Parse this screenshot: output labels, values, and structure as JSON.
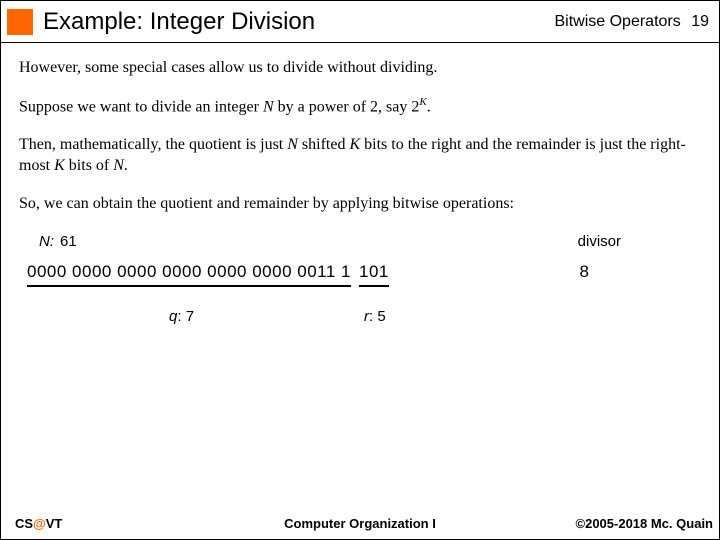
{
  "header": {
    "title": "Example: Integer Division",
    "section": "Bitwise Operators",
    "page": "19"
  },
  "body": {
    "p1": "However, some special cases allow us to divide without dividing.",
    "p2_a": "Suppose we want to divide an integer ",
    "p2_N": "N",
    "p2_b": " by a power of 2, say 2",
    "p2_K": "K",
    "p2_c": ".",
    "p3_a": "Then, mathematically, the quotient is just ",
    "p3_N1": "N",
    "p3_b": " shifted ",
    "p3_K1": "K",
    "p3_c": " bits to the right and the remainder is just the right-most ",
    "p3_K2": "K",
    "p3_d": " bits of ",
    "p3_N2": "N",
    "p3_e": ".",
    "p4": "So, we can obtain the quotient and remainder by applying bitwise operations:"
  },
  "example": {
    "n_label": "N",
    "n_colon": ":",
    "n_value": "61",
    "divisor_label": "divisor",
    "bits_main": "0000 0000 0000 0000 0000 0000 0011 1",
    "bits_tail": "101",
    "divisor_value": "8",
    "q_label": "q",
    "q_colon": ":",
    "q_value": "7",
    "r_label": "r",
    "r_colon": ":",
    "r_value": "5"
  },
  "footer": {
    "cs": "CS",
    "at": "@",
    "vt": "VT",
    "course": "Computer Organization I",
    "copyright": "©2005-2018 Mc. Quain"
  }
}
